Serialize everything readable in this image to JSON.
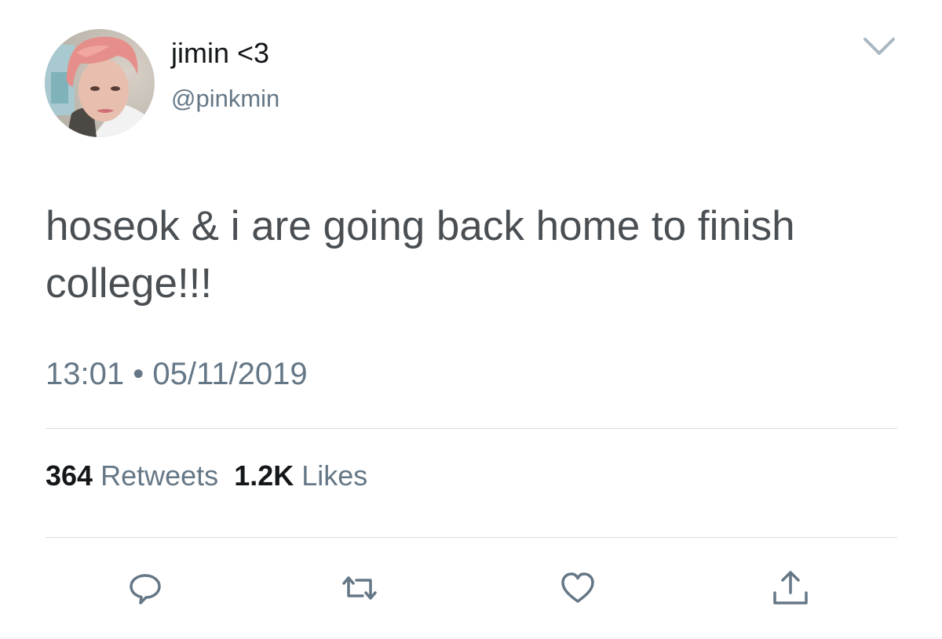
{
  "profile": {
    "display_name": "jimin <3",
    "handle": "@pinkmin",
    "avatar_icon": "avatar-photo"
  },
  "tweet": {
    "text": "hoseok & i are going back home to finish college!!!",
    "time": "13:01",
    "separator": "•",
    "date": "05/11/2019"
  },
  "stats": {
    "retweets_count": "364",
    "retweets_label": "Retweets",
    "likes_count": "1.2K",
    "likes_label": "Likes"
  },
  "actions": [
    {
      "name": "reply",
      "icon": "speech-bubble-icon"
    },
    {
      "name": "retweet",
      "icon": "retweet-arrows-icon"
    },
    {
      "name": "like",
      "icon": "heart-icon"
    },
    {
      "name": "share",
      "icon": "share-upload-icon"
    }
  ],
  "colors": {
    "text_primary": "#14171a",
    "text_secondary": "#657786",
    "tweet_text": "#4a4f54",
    "divider": "#d8dde1",
    "icon": "#657786"
  }
}
